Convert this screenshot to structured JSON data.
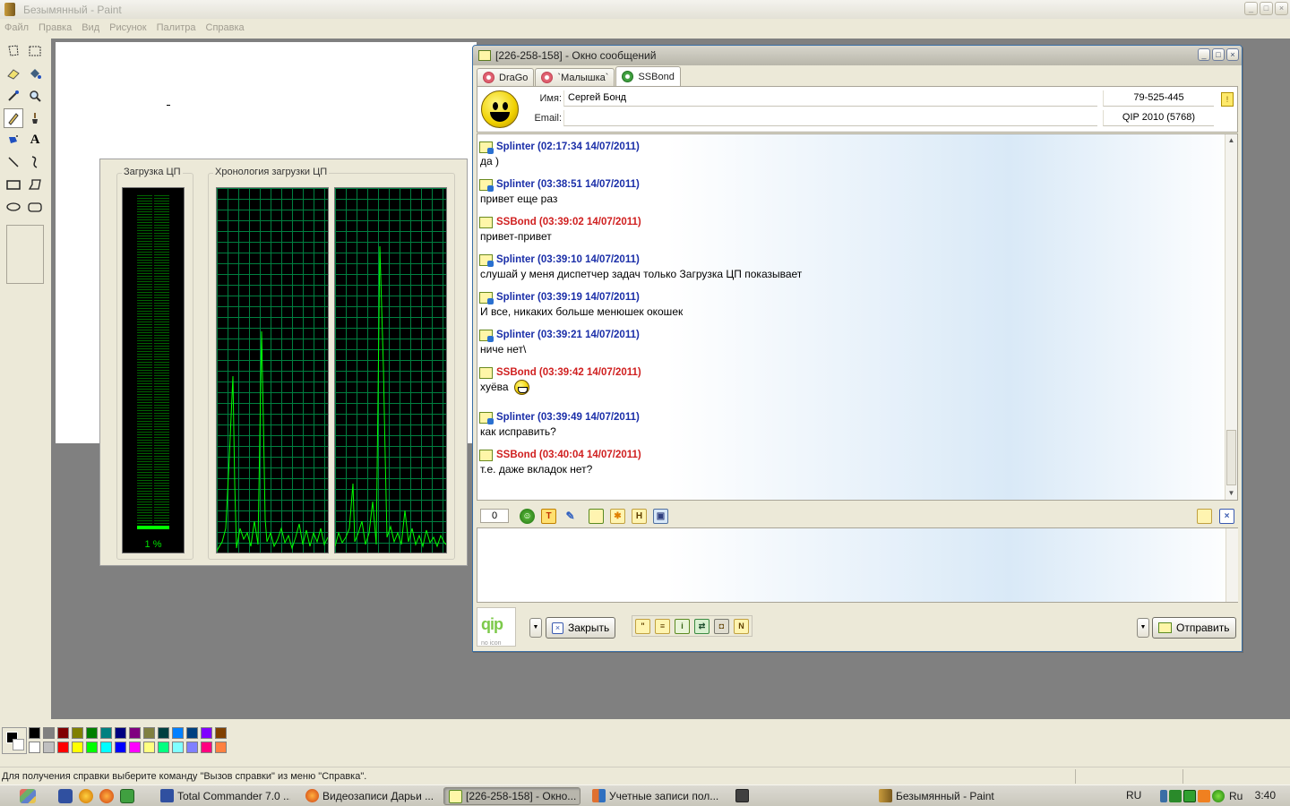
{
  "paint": {
    "title": "Безымянный - Paint",
    "menu": [
      "Файл",
      "Правка",
      "Вид",
      "Рисунок",
      "Палитра",
      "Справка"
    ],
    "status_text": "Для получения справки выберите команду \"Вызов справки\" из меню \"Справка\".",
    "tools": [
      "free-select",
      "rect-select",
      "eraser",
      "fill",
      "eyedropper",
      "magnifier",
      "pencil",
      "brush",
      "airbrush",
      "text",
      "line",
      "curve",
      "rectangle",
      "polygon",
      "ellipse",
      "rounded-rect"
    ],
    "active_tool": "pencil",
    "fg_color": "#000000",
    "bg_color": "#ffffff",
    "palette_top": [
      "#000000",
      "#808080",
      "#800000",
      "#808000",
      "#008000",
      "#008080",
      "#000080",
      "#800080",
      "#808040",
      "#004040",
      "#0080ff",
      "#004080",
      "#8000ff",
      "#804000"
    ],
    "palette_bottom": [
      "#ffffff",
      "#c0c0c0",
      "#ff0000",
      "#ffff00",
      "#00ff00",
      "#00ffff",
      "#0000ff",
      "#ff00ff",
      "#ffff80",
      "#00ff80",
      "#80ffff",
      "#8080ff",
      "#ff0080",
      "#ff8040"
    ]
  },
  "taskmgr": {
    "cpu_usage_label": "Загрузка ЦП",
    "cpu_history_label": "Хронология загрузки ЦП",
    "cpu_percent": "1 %",
    "cpu_fraction": 0.01
  },
  "qip": {
    "title": "[226-258-158] - Окно сообщений",
    "tabs": [
      {
        "label": "DraGo",
        "icon": "flower-red-icon",
        "active": false
      },
      {
        "label": "`Малышка`",
        "icon": "flower-red-icon",
        "active": false
      },
      {
        "label": "SSBond",
        "icon": "flower-green-icon",
        "active": true
      }
    ],
    "contact": {
      "name_label": "Имя:",
      "name_value": "Сергей Бонд",
      "email_label": "Email:",
      "email_value": "",
      "uin": "79-525-445",
      "client": "QIP 2010 (5768)"
    },
    "messages": [
      {
        "from": "in",
        "header": "Splinter (02:17:34 14/07/2011)",
        "text": "да )"
      },
      {
        "from": "in",
        "header": "Splinter (03:38:51 14/07/2011)",
        "text": "привет еще раз"
      },
      {
        "from": "out",
        "header": "SSBond (03:39:02 14/07/2011)",
        "text": "привет-привет"
      },
      {
        "from": "in",
        "header": "Splinter (03:39:10 14/07/2011)",
        "text": "слушай у меня диспетчер задач только Загрузка ЦП показывает"
      },
      {
        "from": "in",
        "header": "Splinter (03:39:19 14/07/2011)",
        "text": "И все, никаких больше менюшек окошек"
      },
      {
        "from": "in",
        "header": "Splinter (03:39:21 14/07/2011)",
        "text": "ниче нет\\"
      },
      {
        "from": "out",
        "header": "SSBond (03:39:42 14/07/2011)",
        "text": "хуёва",
        "emoji": "grin-icon"
      },
      {
        "from": "in",
        "header": "Splinter (03:39:49 14/07/2011)",
        "text": "как исправить?"
      },
      {
        "from": "out",
        "header": "SSBond (03:40:04 14/07/2011)",
        "text": "т.е. даже вкладок нет?"
      }
    ],
    "char_count": "0",
    "edit_icons": [
      "smiley-icon",
      "font-icon",
      "color-icon",
      "save-icon",
      "star-icon",
      "history-icon",
      "image-icon"
    ],
    "input_value": "",
    "close_label": "Закрыть",
    "send_label": "Отправить",
    "action_icons": [
      "quote-icon",
      "note-icon",
      "info-icon",
      "transfer-icon",
      "notify-icon",
      "n-icon"
    ],
    "logo_text": "qip",
    "logo_sub": "no icon",
    "colors": {
      "incoming": "#1a2ea8",
      "outgoing": "#d02020"
    }
  },
  "taskbar": {
    "buttons": [
      {
        "label": "Total Commander 7.0 ...",
        "icon": "total-commander-icon",
        "active": false
      },
      {
        "label": "Видеозаписи Дарьи ...",
        "icon": "firefox-icon",
        "active": false
      },
      {
        "label": "[226-258-158] - Окно...",
        "icon": "qip-icon",
        "active": true
      },
      {
        "label": "Учетные записи пол...",
        "icon": "users-icon",
        "active": false
      },
      {
        "label": "",
        "icon": "taskmgr-icon",
        "active": false
      },
      {
        "label": "Безымянный - Paint",
        "icon": "paint-icon",
        "active": false
      }
    ],
    "lang": "RU",
    "tray_lang": "Ru",
    "clock": "3:40"
  }
}
